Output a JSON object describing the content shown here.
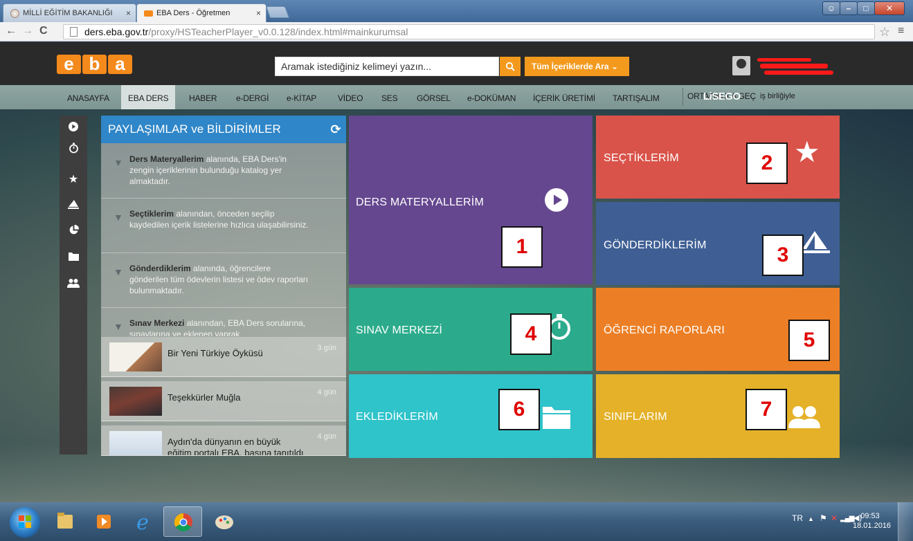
{
  "browser": {
    "tabs": [
      {
        "label": "MİLLİ EĞİTİM BAKANLIĞI"
      },
      {
        "label": "EBA Ders - Öğretmen"
      }
    ],
    "url_host": "ders.eba.gov.tr",
    "url_path": "/proxy/HSTeacherPlayer_v0.0.128/index.html#mainkurumsal"
  },
  "header": {
    "logo_letters": [
      "e",
      "b",
      "a"
    ],
    "search_placeholder": "Aramak istediğiniz kelimeyi yazın...",
    "search_scope": "Tüm İçeriklerde Ara ⌄"
  },
  "menu": {
    "items": [
      "ANASAYFA",
      "EBA DERS",
      "HABER",
      "e-DERGİ",
      "e-KİTAP",
      "VİDEO",
      "SES",
      "GÖRSEL",
      "e-DOKÜMAN",
      "İÇERİK ÜRETİMİ",
      "TARTIŞALIM",
      "ORTAOKULA GEÇ"
    ],
    "active": "EBA DERS",
    "partner_logo": "LiSEGO",
    "partner_text": "iş birliğiyle"
  },
  "sidebar_icons": [
    "play-icon",
    "stopwatch-icon",
    "star-icon",
    "send-icon",
    "pie-chart-icon",
    "folder-icon",
    "users-icon"
  ],
  "panel": {
    "title": "PAYLAŞIMLAR ve BİLDİRİMLER",
    "notes": [
      {
        "bold": "Ders Materyallerim",
        "text": " alanında, EBA Ders'in zengin içeriklerinin bulunduğu katalog yer almaktadır."
      },
      {
        "bold": "Seçtiklerim",
        "text": " alanından, önceden seçilip kaydedilen içerik listelerine hızlıca ulaşabilirsiniz."
      },
      {
        "bold": "Gönderdiklerim",
        "text": " alanında, öğrencilere gönderilen tüm ödevlerin listesi ve ödev raporları bulunmaktadır."
      },
      {
        "bold": "Sınav Merkezi",
        "text": " alanından, EBA Ders sorularına, sınavlarına ve eklenen yaprak"
      }
    ],
    "news": [
      {
        "title": "Bir Yeni Türkiye Öyküsü",
        "ago": "3 gün"
      },
      {
        "title": "Teşekkürler Muğla",
        "ago": "4 gün"
      },
      {
        "title": "Aydın'da dünyanın en büyük eğitim portalı EBA, basına tanıtıldı",
        "ago": "4 gün"
      }
    ]
  },
  "tiles": [
    {
      "label": "DERS MATERYALLERİM",
      "number": "1",
      "color": "#65478f",
      "icon": "play-circle-icon"
    },
    {
      "label": "SEÇTİKLERİM",
      "number": "2",
      "color": "#d9534a",
      "icon": "star-icon"
    },
    {
      "label": "GÖNDERDİKLERİM",
      "number": "3",
      "color": "#3f5f94",
      "icon": "send-icon"
    },
    {
      "label": "SINAV MERKEZİ",
      "number": "4",
      "color": "#2bab8c",
      "icon": "stopwatch-icon"
    },
    {
      "label": "ÖĞRENCİ RAPORLARI",
      "number": "5",
      "color": "#ec7f25",
      "icon": "chart-icon"
    },
    {
      "label": "EKLEDİKLERİM",
      "number": "6",
      "color": "#2fc3ca",
      "icon": "folder-icon"
    },
    {
      "label": "SINIFLARIM",
      "number": "7",
      "color": "#e4b128",
      "icon": "users-icon"
    }
  ],
  "taskbar": {
    "lang": "TR",
    "time": "09:53",
    "date": "18.01.2016"
  }
}
